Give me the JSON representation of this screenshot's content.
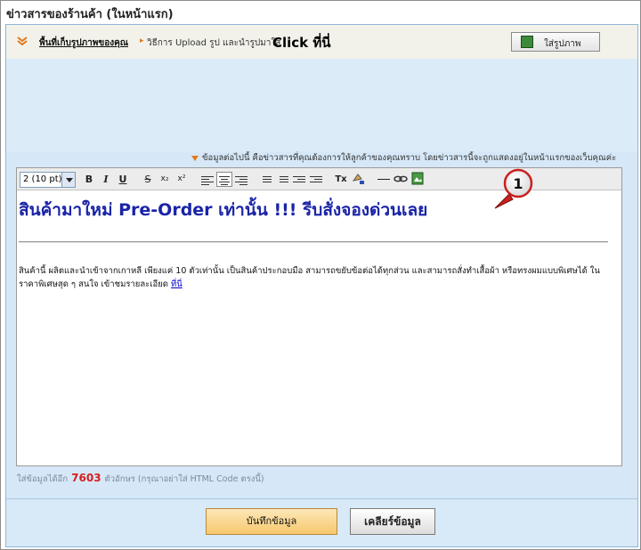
{
  "title": "ข่าวสารของร้านค้า (ในหน้าแรก)",
  "info_bar": {
    "link_text": "พื้นที่เก็บรูปภาพของคุณ",
    "howto": "วิธีการ Upload รูป และนำรูปมาใส่",
    "click_here": "Click ที่นี่",
    "insert_image_label": "ใส่รูปภาพ"
  },
  "notice": "ข้อมูลต่อไปนี้ คือข่าวสารที่คุณต้องการให้ลูกค้าของคุณทราบ โดยข่าวสารนี้จะถูกแสดงอยู่ในหน้าแรกของเว็บคุณค่ะ",
  "toolbar": {
    "font_size_value": "2 (10 pt)",
    "bold": "B",
    "italic": "I",
    "underline": "U",
    "strike": "S",
    "subscript": "x₂",
    "superscript": "x²",
    "remove_format": "Tx"
  },
  "editor": {
    "headline": "สินค้ามาใหม่ Pre-Order เท่านั้น !!! รีบสั่งจองด่วนเลย",
    "body": "สินค้านี้ ผลิตและนำเข้าจากเกาหลี เพียงแค่ 10 ตัวเท่านั้น เป็นสินค้าประกอบมือ สามารถขยับข้อต่อได้ทุกส่วน และสามารถสั่งทำเสื้อผ้า หรือทรงผมแบบพิเศษได้ ในราคาพิเศษสุด ๆ สนใจ เข้าชมรายละเอียด",
    "link": "ที่นี่"
  },
  "callout_number": "1",
  "counter": {
    "prefix": "ใส่ข้อมูลได้อีก",
    "value": "7603",
    "suffix": "ตัวอักษร (กรุณาอย่าใส่ HTML Code ตรงนี้)"
  },
  "buttons": {
    "save": "บันทึกข้อมูล",
    "clear": "เคลียร์ข้อมูล"
  },
  "colors": {
    "headline": "#1a24a8",
    "counter_value": "#d52020",
    "panel_bg": "#d6e8f7",
    "accent_orange": "#e07a20"
  }
}
